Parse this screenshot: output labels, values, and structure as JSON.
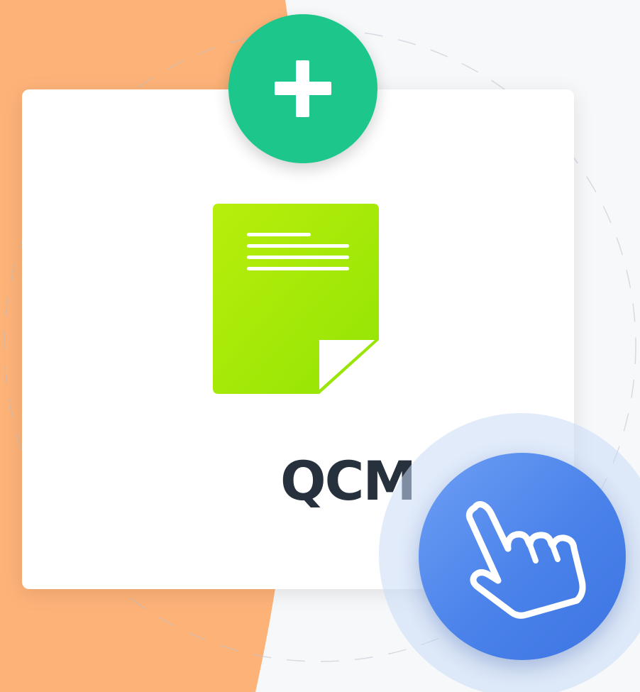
{
  "card": {
    "label": "QCM",
    "document_icon": "document-icon"
  },
  "actions": {
    "add_icon": "plus-icon",
    "pointer_icon": "hand-pointer-icon"
  },
  "colors": {
    "background": "#f7f8fa",
    "accent_orange": "#fdb378",
    "add_green": "#1dc78c",
    "document_green": "#a6ea10",
    "pointer_blue": "#4a82ea",
    "label_text": "#27303d"
  }
}
